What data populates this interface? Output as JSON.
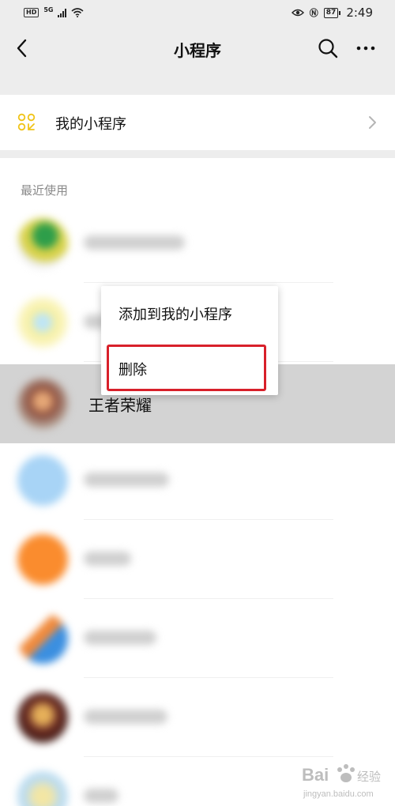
{
  "status_bar": {
    "hd": "HD",
    "network": "5G",
    "battery": "87",
    "time": "2:49",
    "icons": [
      "wifi-icon",
      "eye-icon",
      "nfc-icon",
      "battery-icon"
    ]
  },
  "nav": {
    "title": "小程序",
    "icons": [
      "back-arrow-icon",
      "search-icon",
      "more-icon"
    ]
  },
  "my_card": {
    "label": "我的小程序",
    "icon": "grid-icon",
    "accent": "#f0c419"
  },
  "recent": {
    "header": "最近使用",
    "items": [
      {
        "name": "",
        "blurred": true
      },
      {
        "name": "",
        "blurred": true
      },
      {
        "name": "王者荣耀",
        "blurred": false
      },
      {
        "name": "",
        "blurred": true
      },
      {
        "name": "",
        "blurred": true
      },
      {
        "name": "",
        "blurred": true
      },
      {
        "name": "",
        "blurred": true
      },
      {
        "name": "",
        "blurred": true
      }
    ]
  },
  "popup": {
    "add_label": "添加到我的小程序",
    "delete_label": "删除",
    "highlight_color": "#d8202a"
  },
  "watermark": {
    "brand": "Bai",
    "brand_suffix": "经验",
    "url": "jingyan.baidu.com"
  }
}
